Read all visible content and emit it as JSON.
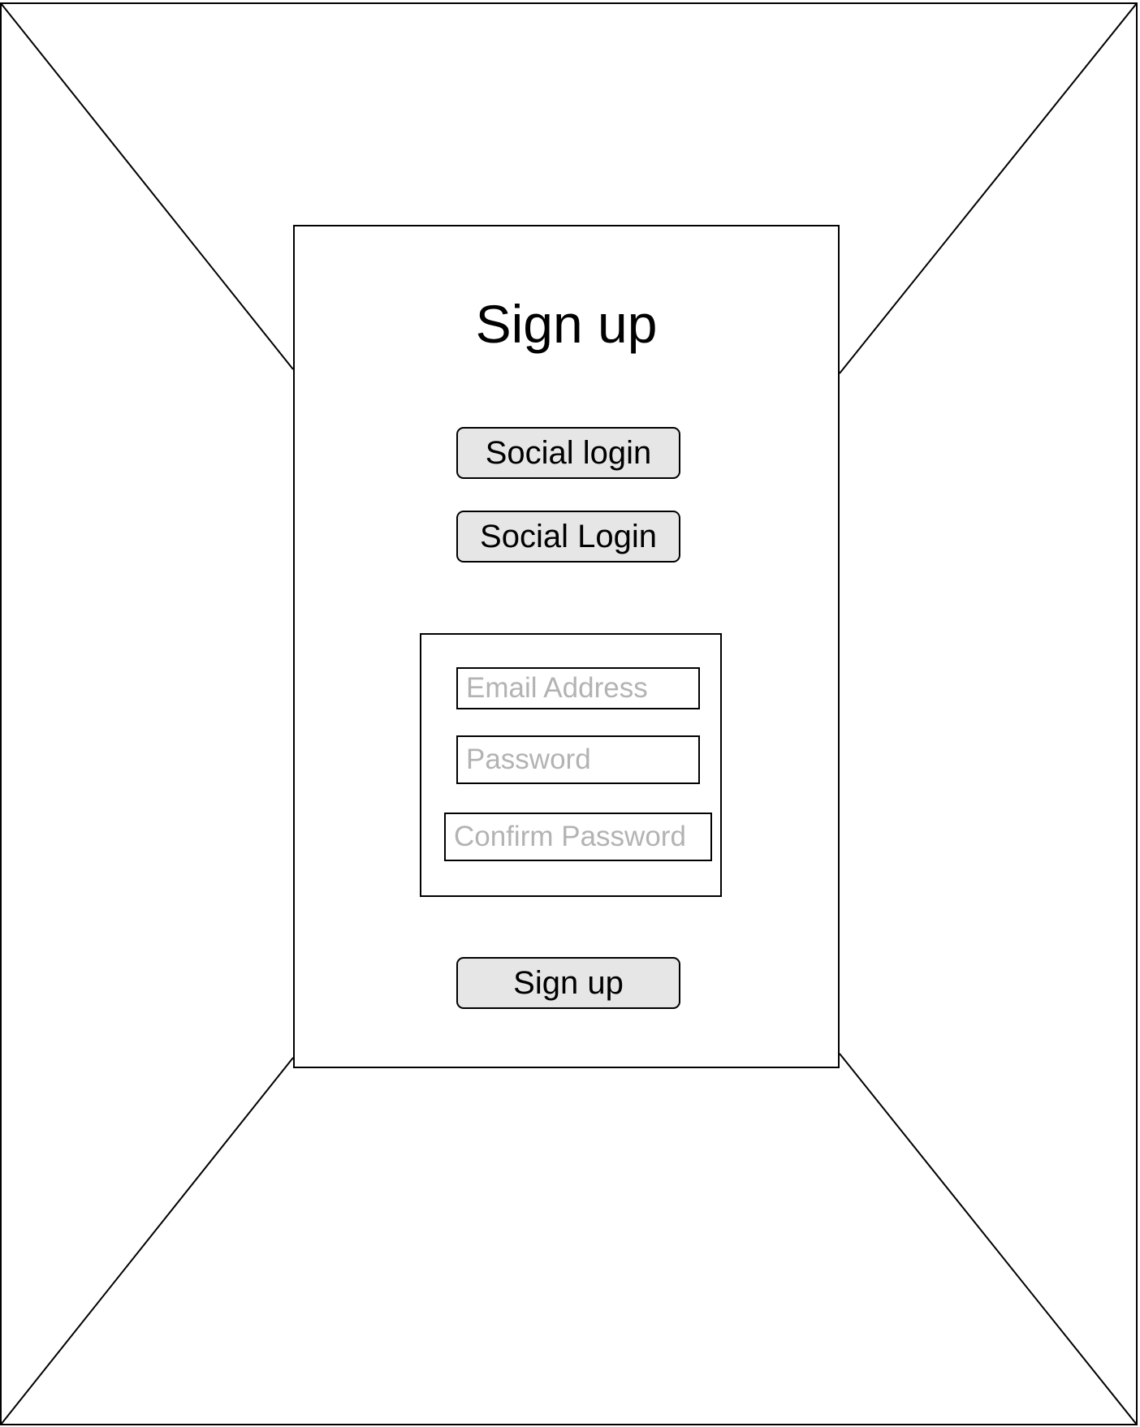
{
  "card": {
    "title": "Sign up"
  },
  "buttons": {
    "social_login_1": "Social login",
    "social_login_2": "Social Login",
    "sign_up": "Sign up"
  },
  "form": {
    "email_placeholder": "Email Address",
    "password_placeholder": "Password",
    "confirm_password_placeholder": "Confirm Password"
  },
  "colors": {
    "button_fill": "#e6e6e6",
    "border": "#000000",
    "placeholder_text": "#b3b3b3"
  }
}
